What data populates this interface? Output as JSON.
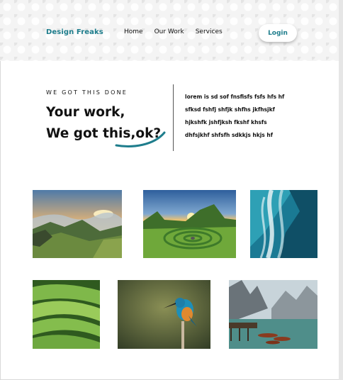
{
  "header": {
    "brand": "Design Freaks",
    "nav": [
      {
        "label": "Home"
      },
      {
        "label": "Our Work"
      },
      {
        "label": "Services"
      }
    ],
    "login_label": "Login"
  },
  "hero": {
    "kicker": "WE GOT THIS DONE",
    "headline_line1": "Your work,",
    "headline_line2": "We got this,ok?",
    "body_lines": [
      "lorem is sd sof  fnsfisfs fsfs hfs hf",
      "sfksd fshfj shfjk shfhs jkfhsjkf",
      "hjkshfk jshfjksh fkshf khsfs",
      "dhfsjkhf shfsfh sdkkjs hkjs hf"
    ]
  },
  "colors": {
    "accent": "#1e7d8c"
  },
  "gallery": [
    {
      "subject": "mountain-valley-sunset"
    },
    {
      "subject": "green-hill-spiral-sunset"
    },
    {
      "subject": "ocean-waves-aerial"
    },
    {
      "subject": "green-rolling-hills"
    },
    {
      "subject": "kingfisher-bird"
    },
    {
      "subject": "alpine-lake-boats"
    }
  ]
}
